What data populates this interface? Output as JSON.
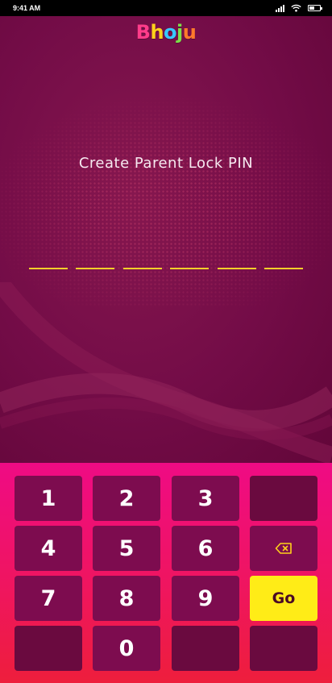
{
  "status_bar": {
    "time": "9:41 AM"
  },
  "app": {
    "logo_letters": [
      "B",
      "h",
      "o",
      "j",
      "u"
    ],
    "title": "Create Parent Lock PIN",
    "pin_slots": 6
  },
  "keypad": {
    "keys": [
      "1",
      "2",
      "3",
      "4",
      "5",
      "6",
      "7",
      "8",
      "9",
      "0"
    ],
    "go_label": "Go"
  },
  "icons": {
    "backspace": "backspace-icon",
    "signal": "signal-icon",
    "wifi": "wifi-icon",
    "battery": "battery-icon"
  },
  "colors": {
    "background": "#730c47",
    "pin_underline": "#f2cf2a",
    "key": "#7d0c4f",
    "go_key": "#ffec17",
    "keypad_top": "#ef0b84",
    "keypad_bottom": "#ee1e3c"
  },
  "battery_level": 0.5
}
